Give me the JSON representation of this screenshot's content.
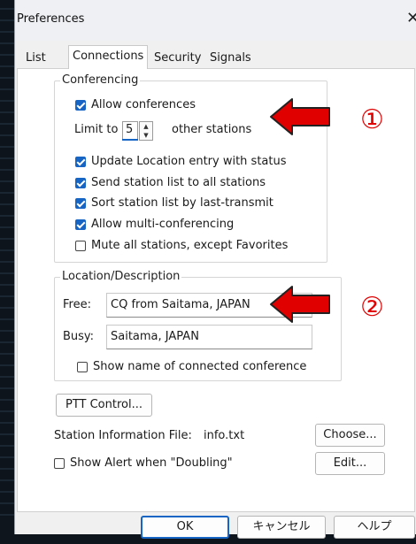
{
  "window": {
    "title": "Preferences"
  },
  "tabs": [
    {
      "label": "List",
      "active": false
    },
    {
      "label": "Connections",
      "active": true
    },
    {
      "label": "Security",
      "active": false
    },
    {
      "label": "Signals",
      "active": false
    }
  ],
  "conferencing": {
    "group_label": "Conferencing",
    "allow_conferences": {
      "label": "Allow conferences",
      "checked": true
    },
    "limit_label": "Limit to",
    "limit_value": "5",
    "limit_suffix": "other stations",
    "options": [
      {
        "label": "Update Location entry with status",
        "checked": true
      },
      {
        "label": "Send station list to all stations",
        "checked": true
      },
      {
        "label": "Sort station list by last-transmit",
        "checked": true
      },
      {
        "label": "Allow multi-conferencing",
        "checked": true
      },
      {
        "label": "Mute all stations, except Favorites",
        "checked": false
      }
    ]
  },
  "location": {
    "group_label": "Location/Description",
    "free_label": "Free:",
    "free_value": "CQ from Saitama, JAPAN",
    "busy_label": "Busy:",
    "busy_value": "Saitama, JAPAN",
    "show_conference": {
      "label": "Show name of connected conference",
      "checked": false
    }
  },
  "ptt_button": "PTT Control...",
  "station_info": {
    "label": "Station Information File:",
    "file": "info.txt",
    "choose_button": "Choose..."
  },
  "show_alert": {
    "label": "Show Alert when \"Doubling\"",
    "checked": false
  },
  "edit_button": "Edit...",
  "footer": {
    "ok": "OK",
    "cancel": "キャンセル",
    "help": "ヘルプ"
  },
  "annotations": {
    "marker_1": "①",
    "marker_2": "②",
    "arrow_color": "#e00000"
  }
}
